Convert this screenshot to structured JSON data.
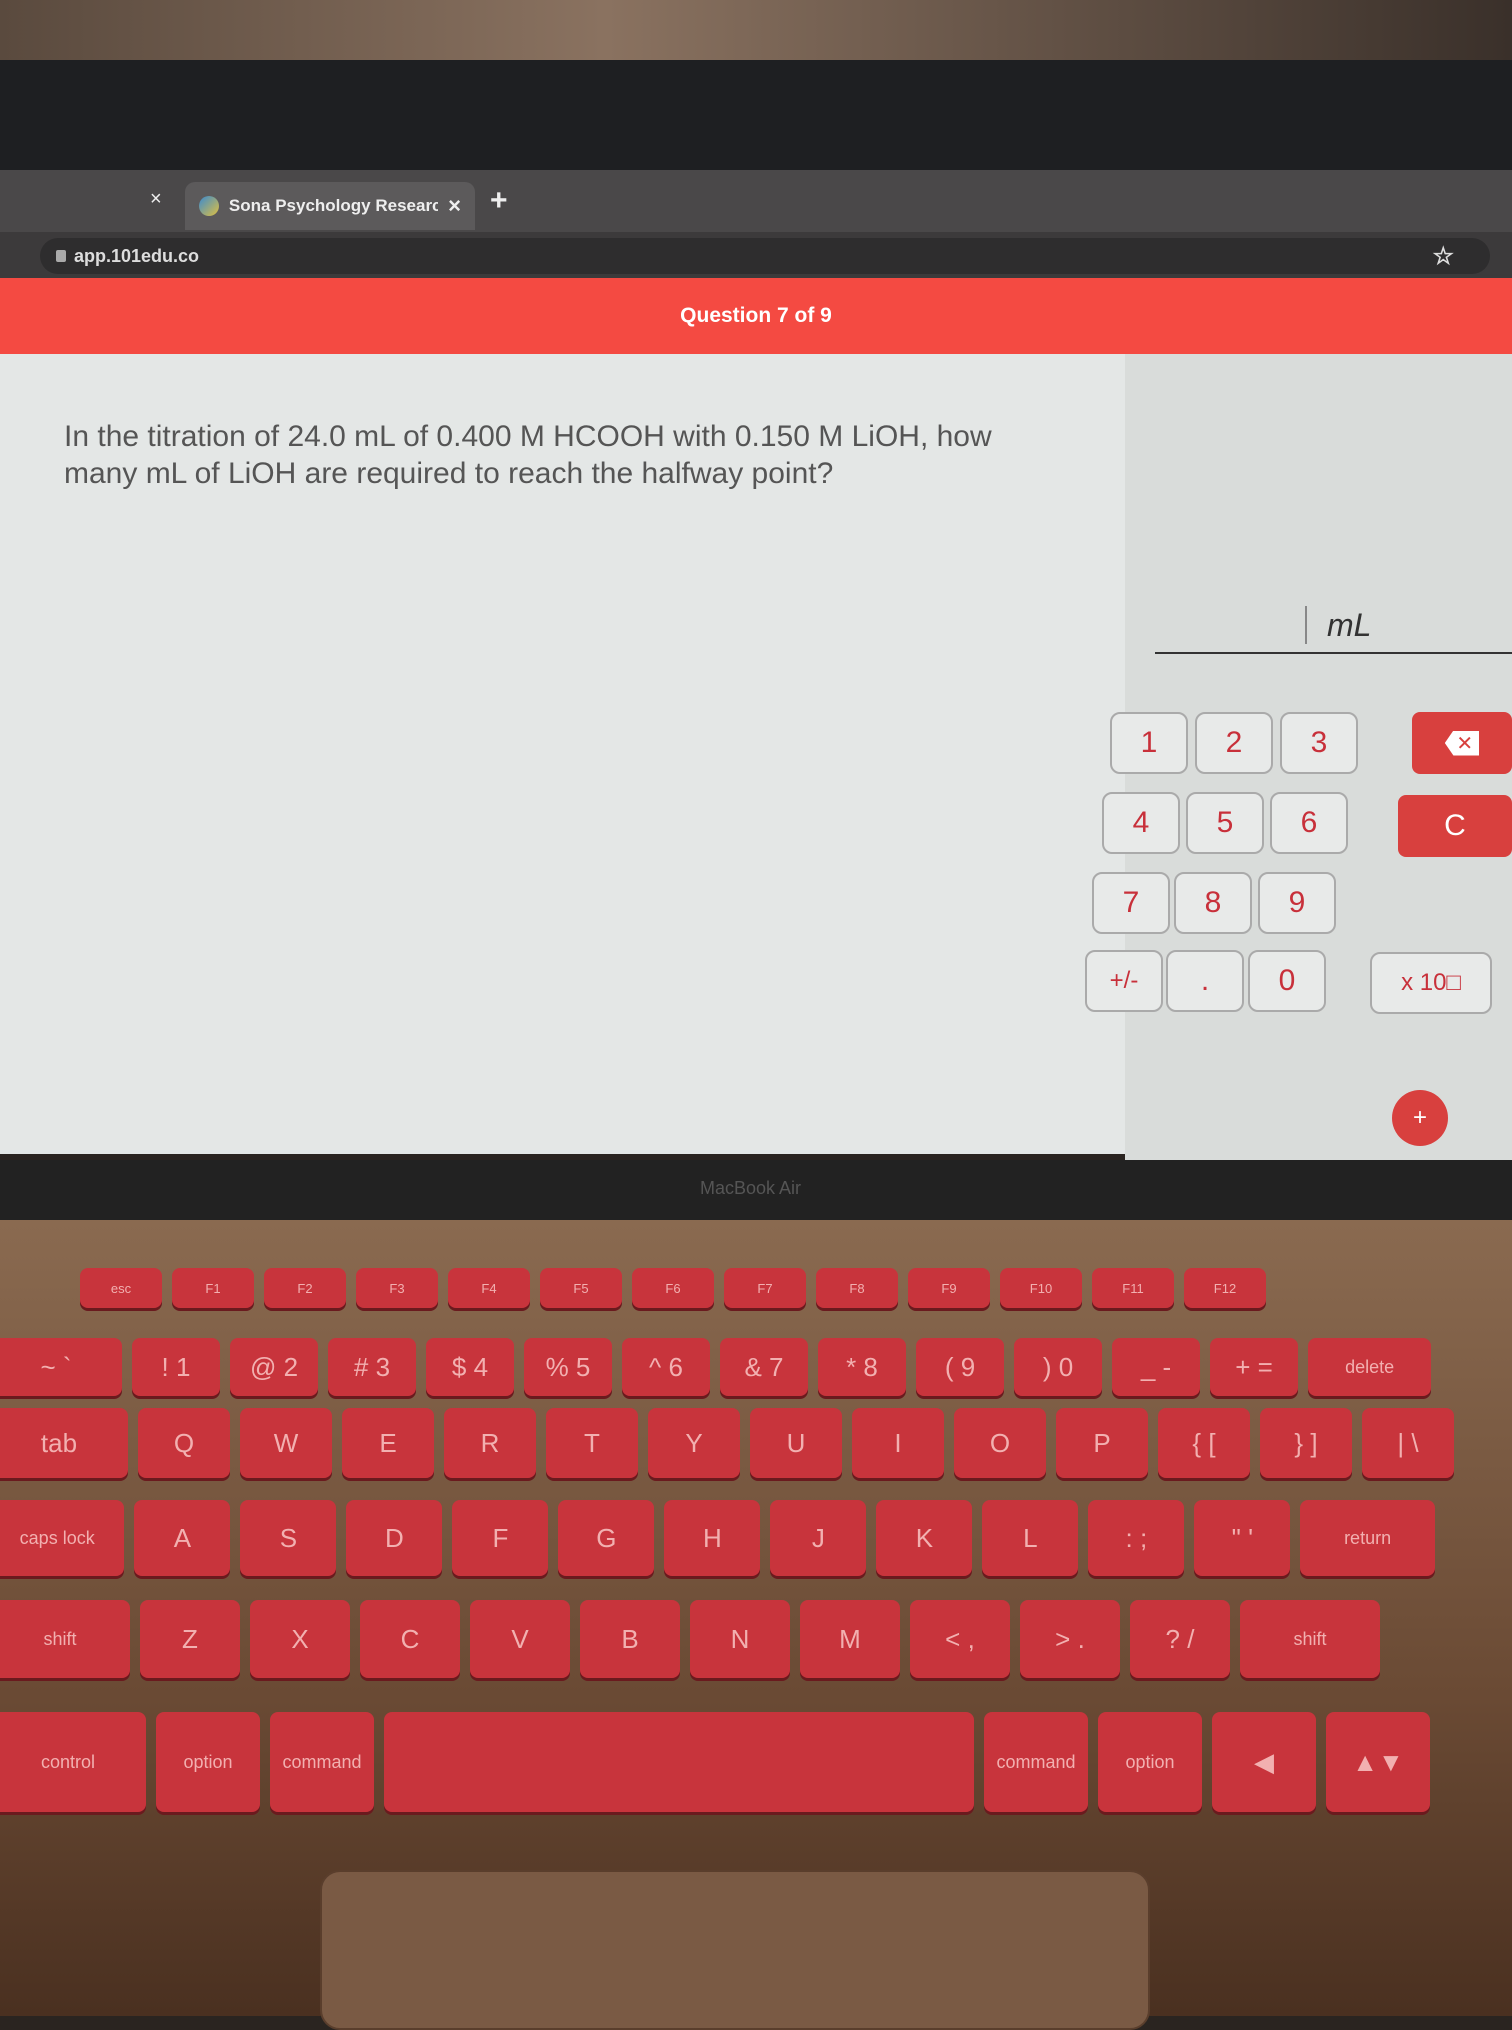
{
  "browser": {
    "tabs": [
      {
        "label": "Sona Psychology Research Pa",
        "close": "×"
      }
    ],
    "prev_tab_close": "×",
    "new_tab": "+",
    "url": "app.101edu.co",
    "bookmark_icon": "star-icon"
  },
  "header": {
    "progress": "Question 7 of 9"
  },
  "question": {
    "text": "In the titration of 24.0 mL of 0.400 M HCOOH with 0.150 M LiOH, how many mL of LiOH are required to reach the halfway point?"
  },
  "answer": {
    "value": "",
    "unit": "mL"
  },
  "keypad": {
    "digits": [
      "1",
      "2",
      "3",
      "4",
      "5",
      "6",
      "7",
      "8",
      "9"
    ],
    "sign": "+/-",
    "decimal": ".",
    "zero": "0",
    "clear": "C",
    "sci": "x 10□",
    "add": "+",
    "accent": "#d8403e"
  },
  "laptop": {
    "brand": "MacBook Air"
  },
  "keyboard": {
    "fn_row": [
      "esc",
      "F1",
      "F2",
      "F3",
      "F4",
      "F5",
      "F6",
      "F7",
      "F8",
      "F9",
      "F10",
      "F11",
      "F12"
    ],
    "number_row": [
      "~ `",
      "! 1",
      "@ 2",
      "# 3",
      "$ 4",
      "% 5",
      "^ 6",
      "& 7",
      "* 8",
      "( 9",
      ") 0",
      "_ -",
      "+ =",
      "delete"
    ],
    "top_row": [
      "tab",
      "Q",
      "W",
      "E",
      "R",
      "T",
      "Y",
      "U",
      "I",
      "O",
      "P",
      "{ [",
      "} ]",
      "| \\"
    ],
    "home_row": [
      "caps lock",
      "A",
      "S",
      "D",
      "F",
      "G",
      "H",
      "J",
      "K",
      "L",
      ": ;",
      "\" '",
      "return"
    ],
    "bottom_row": [
      "shift",
      "Z",
      "X",
      "C",
      "V",
      "B",
      "N",
      "M",
      "< ,",
      "> .",
      "? /",
      "shift"
    ],
    "mod_row": [
      "control",
      "option",
      "command",
      "",
      "command",
      "option",
      "◀",
      "▲▼"
    ]
  }
}
